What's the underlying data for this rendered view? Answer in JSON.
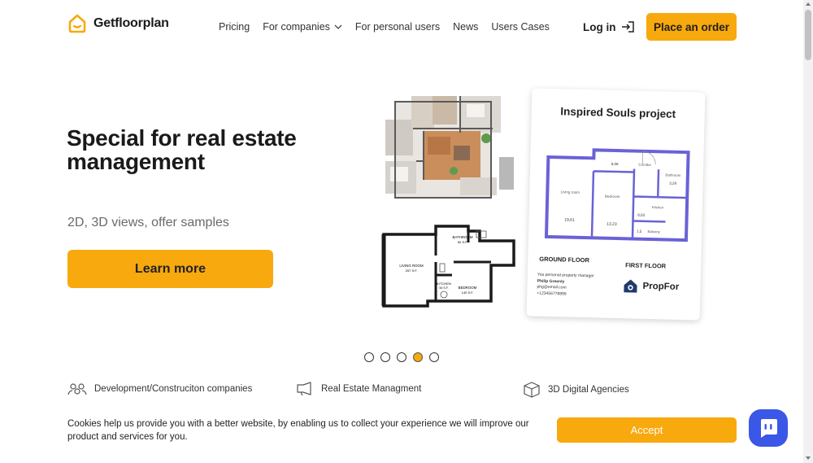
{
  "header": {
    "logo_text": "Getfloorplan",
    "nav": [
      {
        "label": "Pricing",
        "has_dropdown": false
      },
      {
        "label": "For companies",
        "has_dropdown": true
      },
      {
        "label": "For personal users",
        "has_dropdown": false
      },
      {
        "label": "News",
        "has_dropdown": false
      },
      {
        "label": "Users Cases",
        "has_dropdown": false
      }
    ],
    "login_label": "Log in",
    "order_label": "Place an order"
  },
  "hero": {
    "title": "Special for real estate management",
    "subtitle": "2D, 3D views, offer samples",
    "cta_label": "Learn more"
  },
  "plan2d": {
    "bathroom": "BATHROOM",
    "bathroom_area": "50 S.F.",
    "living": "LIVING ROOM",
    "living_area": "257 S.F.",
    "kitchen": "KITCHEN",
    "kitchen_area": "50 S.F.",
    "bedroom": "BEDROOM",
    "bedroom_area": "140 S.F."
  },
  "card": {
    "title": "Inspired Souls project",
    "rooms": {
      "living": "Living room",
      "living_area": "19,61",
      "bedroom": "Bedroom",
      "bedroom_area": "13,23",
      "corridor": "Corridor",
      "corridor_area": "8,08",
      "bathroom": "Bathroom",
      "bathroom_area": "3,29",
      "kitchen": "Kitchen",
      "kitchen_area": "8,03",
      "balcony": "Balcony",
      "balcony_area": "1,5"
    },
    "ground_floor": "GROUND FLOOR",
    "first_floor": "FIRST FLOOR",
    "contact": {
      "line1": "You personal property manager",
      "name": "Philip Greenly",
      "email": "phg@email.com",
      "phone": "+123456778899"
    },
    "brand": "PropFor"
  },
  "carousel": {
    "count": 5,
    "active_index": 3
  },
  "categories": [
    {
      "label": "Development/Construciton companies",
      "icon": "people-icon"
    },
    {
      "label": "Real Estate Managment",
      "icon": "megaphone-icon"
    },
    {
      "label": "3D Digital Agencies",
      "icon": "cube-icon"
    }
  ],
  "cookie": {
    "text": "Cookies help us provide you with a better website, by enabling us to collect your experience we will improve our product and services for you.",
    "accept_label": "Accept"
  },
  "colors": {
    "accent": "#f8a90d",
    "chat": "#3a57e8",
    "plan_wall": "#6a62d6"
  }
}
